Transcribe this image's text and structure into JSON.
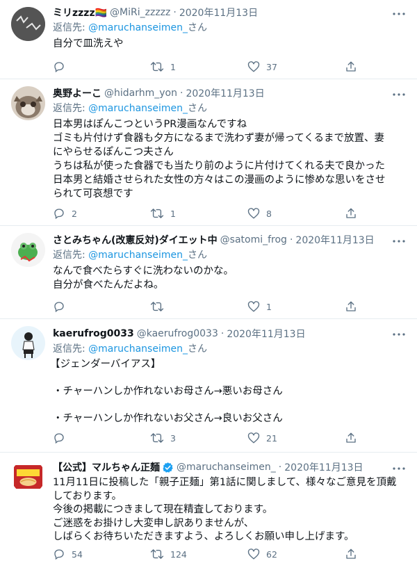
{
  "reply_prefix": "返信先: ",
  "tweets": [
    {
      "name": "ミリzzzz🏳️‍🌈",
      "handle": "@MiRi_zzzzz",
      "date": "2020年11月13日",
      "reply_to": "@maruchanseimen_",
      "reply_suffix": "さん",
      "lines": [
        "自分で皿洗えや"
      ],
      "reply_count": "",
      "retweet_count": "1",
      "like_count": "37"
    },
    {
      "name": "奥野よーこ",
      "handle": "@hidarhm_yon",
      "date": "2020年11月13日",
      "reply_to": "@maruchanseimen_",
      "reply_suffix": "さん",
      "lines": [
        "日本男はぽんこつというPR漫画なんですね",
        "ゴミも片付けず食器も夕方になるまで洗わず妻が帰ってくるまで放置、妻",
        "にやらせるぽんこつ夫さん",
        "うちは私が使った食器でも当たり前のように片付けてくれる夫で良かった",
        "日本男と結婚させられた女性の方々はこの漫画のように惨めな思いをさせ",
        "られて可哀想です"
      ],
      "reply_count": "2",
      "retweet_count": "1",
      "like_count": "8"
    },
    {
      "name": "さとみちゃん(改憲反対)ダイエット中",
      "handle": "@satomi_frog",
      "date": "2020年11月13日",
      "reply_to": "@maruchanseimen_",
      "reply_suffix": "さん",
      "lines": [
        "なんで食べたらすぐに洗わないのかな。",
        "自分が食べたんだよね。"
      ],
      "reply_count": "",
      "retweet_count": "",
      "like_count": "1"
    },
    {
      "name": "kaerufrog0033",
      "handle": "@kaerufrog0033",
      "date": "2020年11月13日",
      "reply_to": "@maruchanseimen_",
      "reply_suffix": "さん",
      "lines": [
        "【ジェンダーバイアス】",
        "",
        "・チャーハンしか作れないお母さん→悪いお母さん",
        "",
        "・チャーハンしか作れないお父さん→良いお父さん"
      ],
      "reply_count": "",
      "retweet_count": "3",
      "like_count": "21"
    },
    {
      "name": "【公式】マルちゃん正麺",
      "handle": "@maruchanseimen_",
      "date": "2020年11月13日",
      "verified": true,
      "lines": [
        "11月11日に投稿した「親子正麺」第1話に関しまして、様々なご意見を頂戴",
        "しております。",
        "今後の掲載につきまして現在精査しております。",
        "ご迷惑をお掛けし大変申し訳ありませんが、",
        "しばらくお待ちいただきますよう、よろしくお願い申し上げます。"
      ],
      "reply_count": "54",
      "retweet_count": "124",
      "like_count": "62"
    }
  ],
  "colors": {
    "text": "#0f1419",
    "secondary": "#5b7083",
    "link": "#1b95e0",
    "border": "#e6ecf0",
    "verified": "#1da1f2"
  }
}
